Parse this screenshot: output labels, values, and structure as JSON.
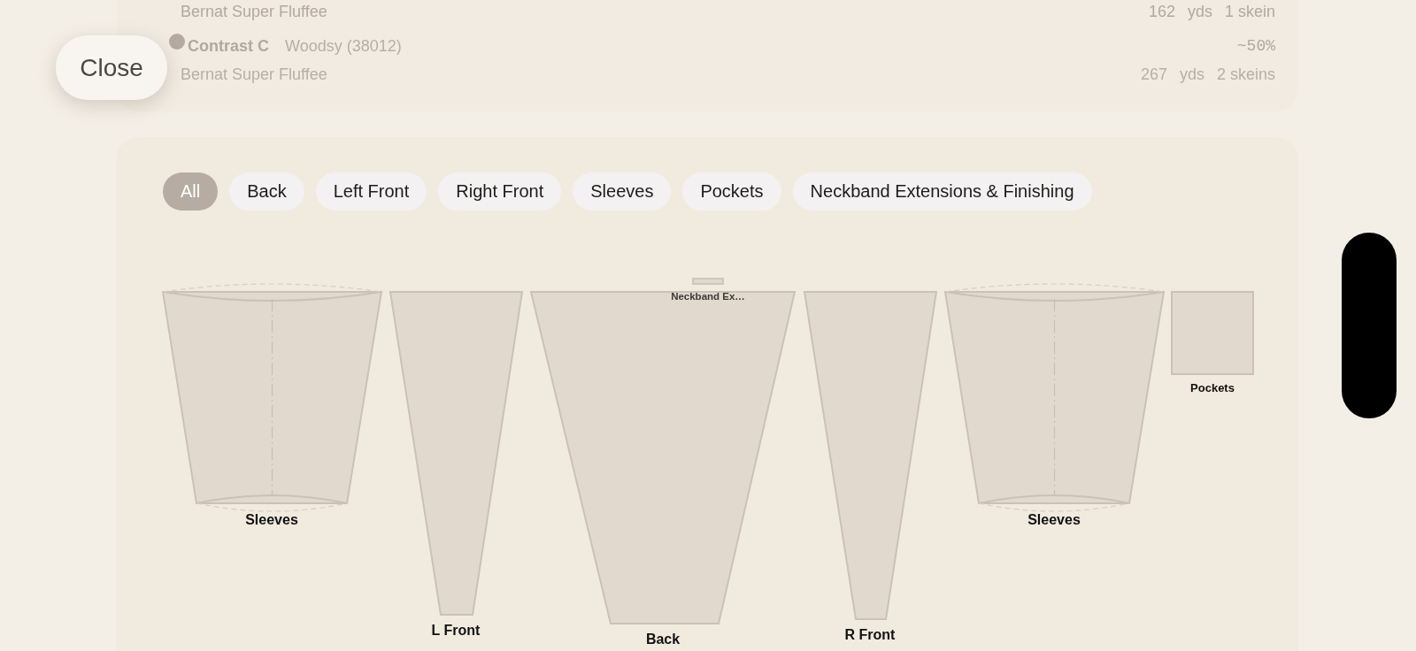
{
  "close_button": {
    "label": "Close"
  },
  "yarn_list": [
    {
      "brand": "Bernat Super Fluffee",
      "yards": "162",
      "yards_unit": "yds",
      "skeins": "1 skein"
    },
    {
      "tag": "Contrast C",
      "name": "Woodsy (38012)",
      "brand": "Bernat Super Fluffee",
      "share": "~50%",
      "yards": "267",
      "yards_unit": "yds",
      "skeins": "2 skeins"
    }
  ],
  "filters": [
    {
      "label": "All",
      "selected": true
    },
    {
      "label": "Back",
      "selected": false
    },
    {
      "label": "Left Front",
      "selected": false
    },
    {
      "label": "Right Front",
      "selected": false
    },
    {
      "label": "Sleeves",
      "selected": false
    },
    {
      "label": "Pockets",
      "selected": false
    },
    {
      "label": "Neckband Extensions & Finishing",
      "selected": false
    }
  ],
  "pieces": [
    {
      "kind": "sleeve",
      "label": "Sleeves"
    },
    {
      "kind": "taper",
      "label": "L Front"
    },
    {
      "kind": "taper",
      "label": "Back"
    },
    {
      "kind": "band",
      "label": "Neckband Ex…"
    },
    {
      "kind": "taper",
      "label": "R Front"
    },
    {
      "kind": "sleeve",
      "label": "Sleeves"
    },
    {
      "kind": "square",
      "label": "Pockets"
    }
  ]
}
